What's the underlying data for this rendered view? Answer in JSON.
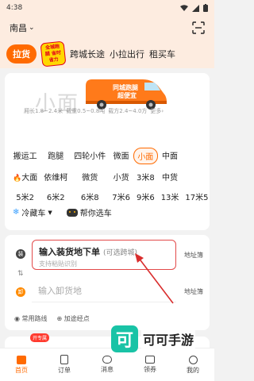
{
  "status_bar": {
    "time": "4:38"
  },
  "header": {
    "city": "南昌",
    "city_chevron": "⌄"
  },
  "tabs": [
    {
      "label": "拉货",
      "active": true
    },
    {
      "label": "全城跑腿 省时省力",
      "badge": true
    },
    {
      "label": "跨城长途"
    },
    {
      "label": "小拉出行"
    },
    {
      "label": "租买车"
    }
  ],
  "hero": {
    "title": "小面",
    "van_text": "同城跑腿 超便宜",
    "specs": [
      "厢长1.8~2.4米",
      "载重0.5~0.8吨",
      "载方2.4~4.0方",
      "更多›"
    ]
  },
  "vehicle_types": [
    "搬运工",
    "跑腿",
    "四轮小件",
    "微面",
    "小面",
    "中面",
    "",
    "大面",
    "依维柯",
    "微货",
    "小货",
    "3米8",
    "中货",
    "",
    "5米2",
    "6米2",
    "6米8",
    "7米6",
    "9米6",
    "13米",
    "17米5"
  ],
  "vehicle_fire_prefix": "🔥",
  "extras": {
    "cold_truck": "冷藏车",
    "help_choose": "帮你选车"
  },
  "address": {
    "load_dot": "装",
    "unload_dot": "卸",
    "swap": "⇅",
    "load_title": "输入装货地下单",
    "load_optional": "(可选跨城)",
    "load_sub": "支持粘贴识别",
    "unload_placeholder": "输入卸货地",
    "address_book": "地址簿",
    "common_routes": "常用路线",
    "add_stop": "加途经点"
  },
  "promo_badge": "开专属",
  "watermark": {
    "logo": "可",
    "text": "可可手游"
  },
  "nav": [
    {
      "label": "首页",
      "active": true
    },
    {
      "label": "订单"
    },
    {
      "label": "消息"
    },
    {
      "label": "领券"
    },
    {
      "label": "我的"
    }
  ],
  "colors": {
    "accent": "#ff6a00",
    "header_bg": "#fdece0",
    "arrow": "#d92d2d"
  }
}
